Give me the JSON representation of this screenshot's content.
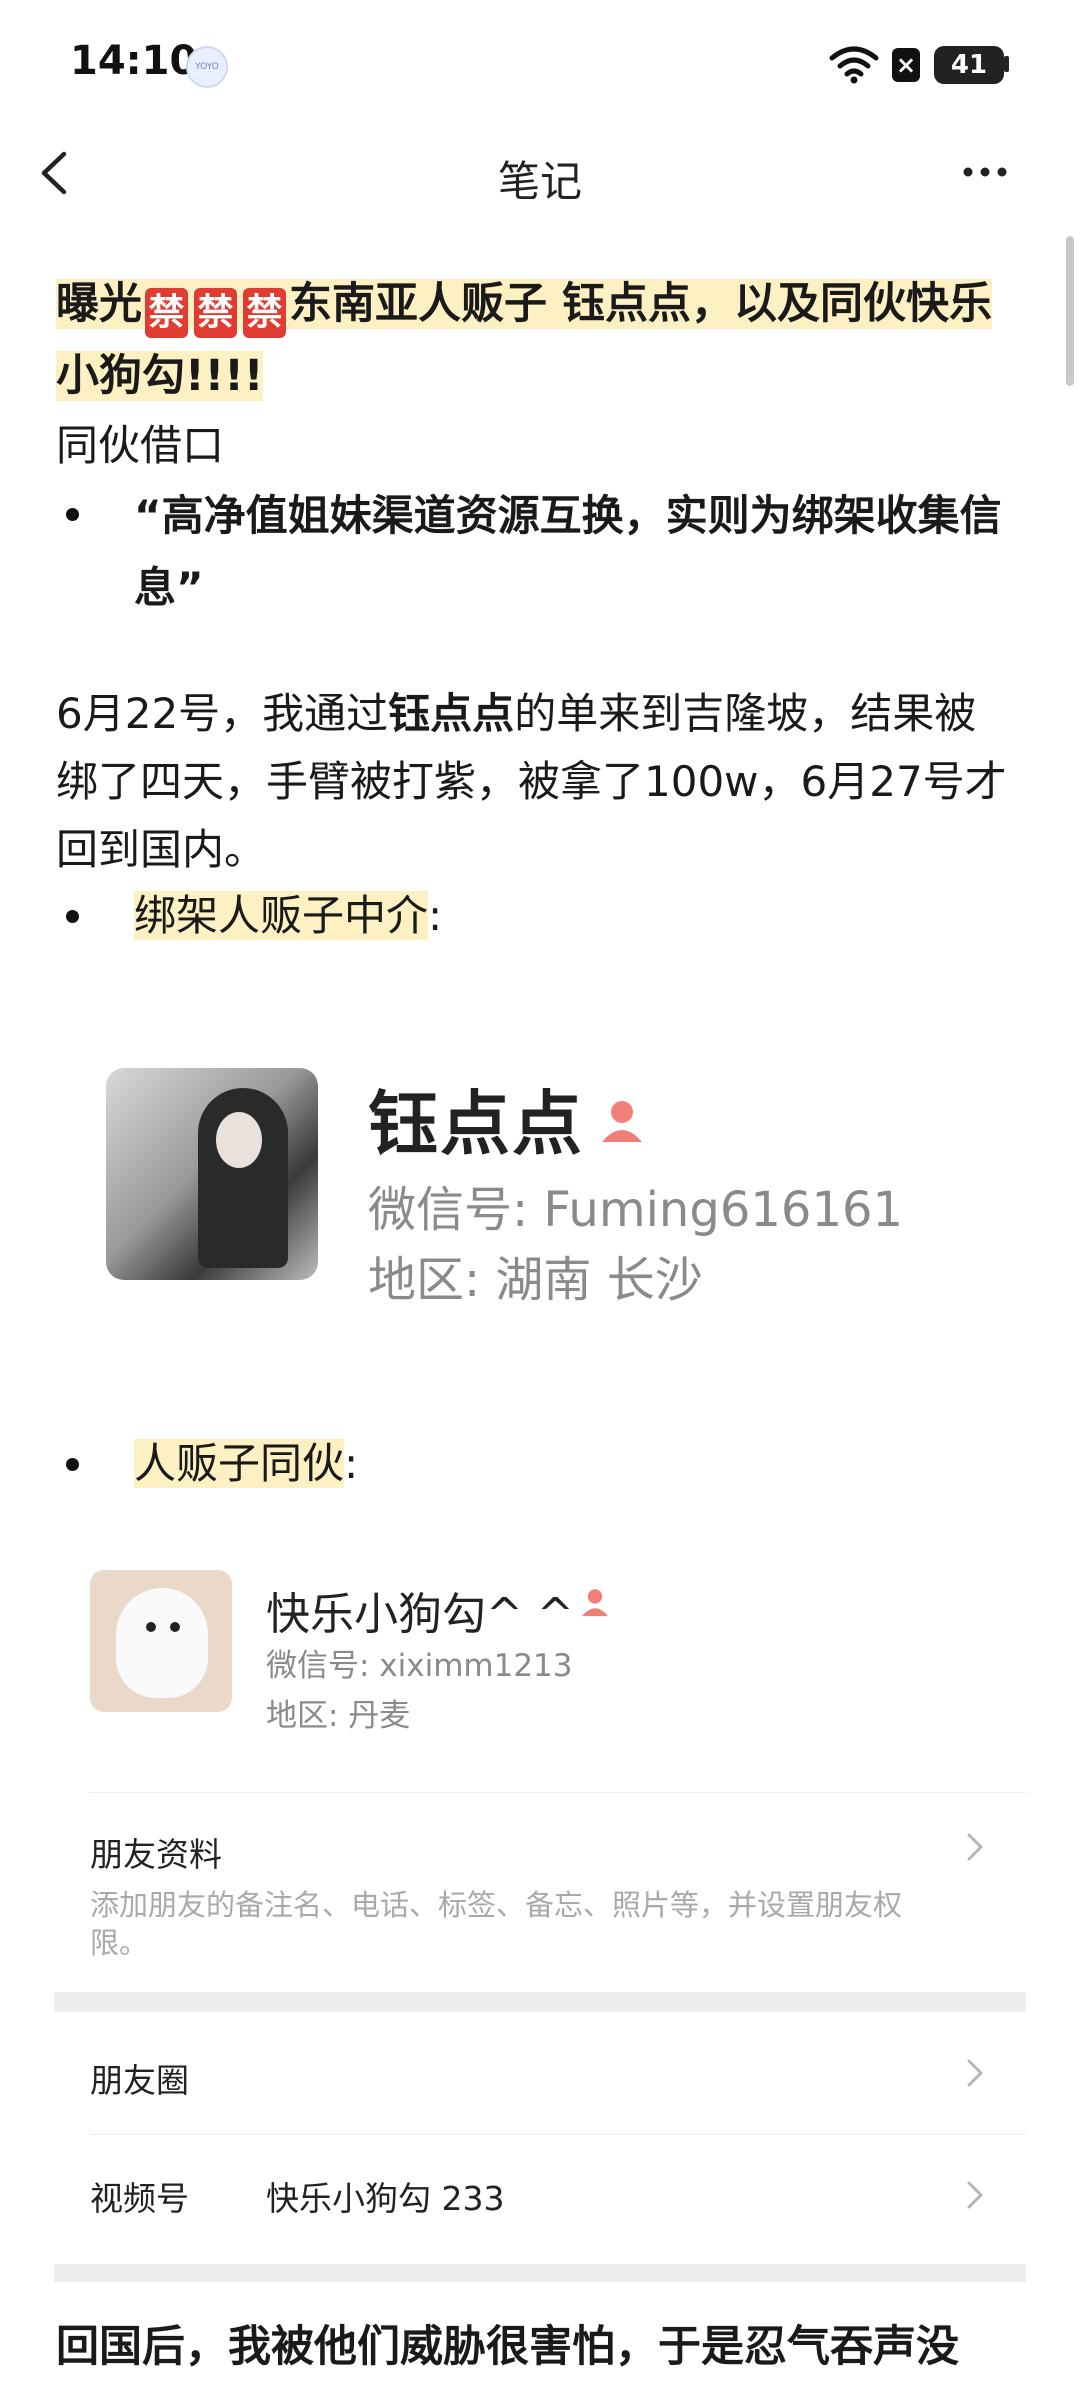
{
  "status_bar": {
    "time": "14:10",
    "app_badge": "YOYO",
    "battery": "41"
  },
  "nav": {
    "title": "笔记"
  },
  "post": {
    "headline_prefix": "曝光",
    "ban_char": "禁",
    "headline_suffix": "东南亚人贩子 钰点点，以及同伙快乐小狗勾!!!!",
    "subtitle": "同伙借口",
    "quote": "“高净值姐妹渠道资源互换，实则为绑架收集信息”",
    "para_1": "6月22号，我通过",
    "para_bold": "钰点点",
    "para_2": "的单来到吉隆坡，结果被绑了四天，手臂被打紫，被拿了100w，6月27号才回到国内。",
    "label_broker": "绑架人贩子中介",
    "label_accomplice": "人贩子同伙",
    "colon": ":",
    "bottom": "回国后，我被他们威胁很害怕，于是忍气吞声没"
  },
  "broker_card": {
    "name": "钰点点",
    "wechat": "微信号: Fuming616161",
    "region": "地区: 湖南 长沙"
  },
  "accomplice_card": {
    "name": "快乐小狗勾^ ^",
    "wechat": "微信号: xiximm1213",
    "region": "地区: 丹麦",
    "friend_info_title": "朋友资料",
    "friend_info_sub": "添加朋友的备注名、电话、标签、备忘、照片等，并设置朋友权限。",
    "moments": "朋友圈",
    "channels_label": "视频号",
    "channels_value": "快乐小狗勾 233"
  }
}
